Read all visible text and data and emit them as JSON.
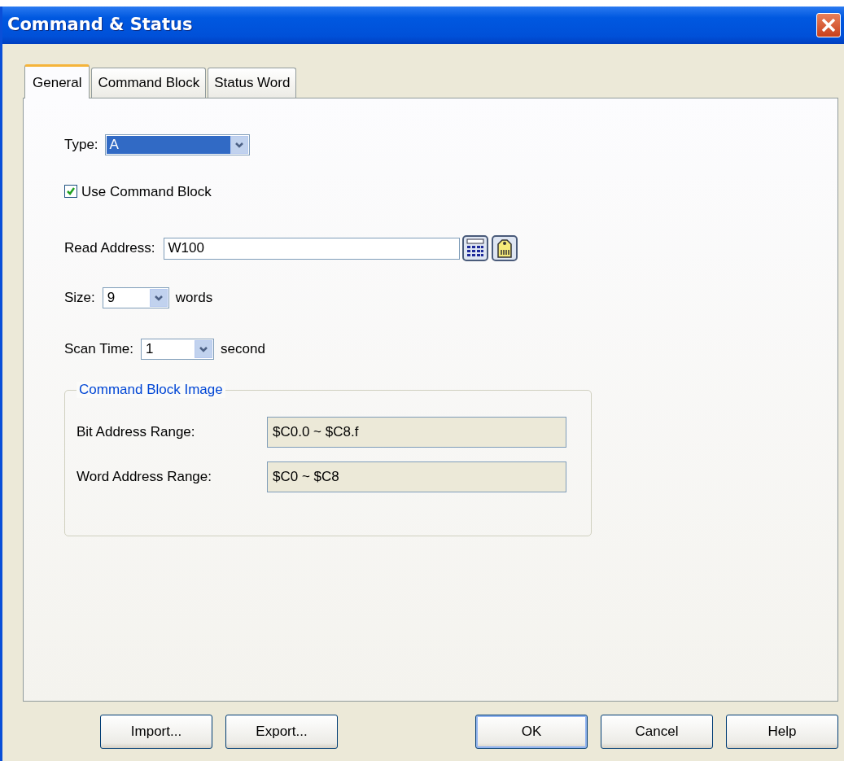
{
  "window": {
    "title": "Command & Status"
  },
  "tabs": [
    {
      "label": "General",
      "selected": true
    },
    {
      "label": "Command Block",
      "selected": false
    },
    {
      "label": "Status Word",
      "selected": false
    }
  ],
  "type": {
    "label": "Type:",
    "value": "A",
    "highlighted": true
  },
  "use_command_block": {
    "label": "Use Command Block",
    "checked": true
  },
  "read_address": {
    "label": "Read Address:",
    "value": "W100"
  },
  "size": {
    "label": "Size:",
    "value": "9",
    "unit": "words"
  },
  "scan_time": {
    "label": "Scan Time:",
    "value": "1",
    "unit": "second"
  },
  "command_block_image": {
    "title": "Command Block Image",
    "rows": [
      {
        "label": "Bit Address Range:",
        "value": "$C0.0 ~ $C8.f"
      },
      {
        "label": "Word Address Range:",
        "value": "$C0 ~ $C8"
      }
    ]
  },
  "buttons_left": [
    {
      "label": "Import...",
      "default": false
    },
    {
      "label": "Export...",
      "default": false
    }
  ],
  "buttons_right": [
    {
      "label": "OK",
      "default": true
    },
    {
      "label": "Cancel",
      "default": false
    },
    {
      "label": "Help",
      "default": false
    }
  ]
}
